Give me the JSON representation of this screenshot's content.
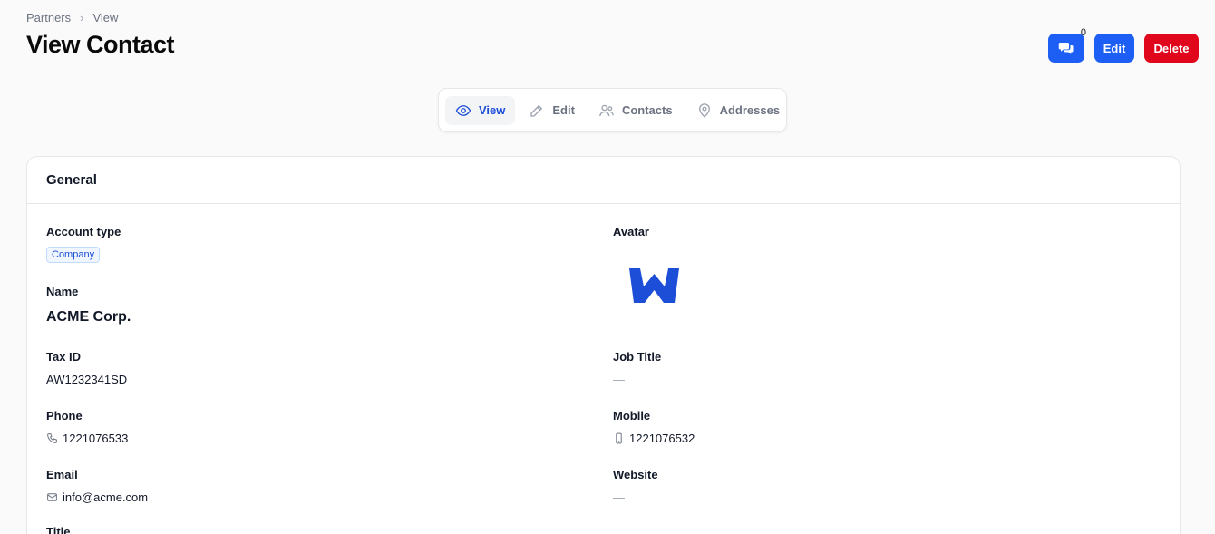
{
  "breadcrumb": {
    "parent": "Partners",
    "separator": "›",
    "current": "View"
  },
  "page": {
    "title": "View Contact"
  },
  "actions": {
    "comments_count": "0",
    "edit_label": "Edit",
    "delete_label": "Delete"
  },
  "tabs": [
    {
      "label": "View",
      "icon": "eye-icon",
      "active": true
    },
    {
      "label": "Edit",
      "icon": "pencil-icon",
      "active": false
    },
    {
      "label": "Contacts",
      "icon": "users-icon",
      "active": false
    },
    {
      "label": "Addresses",
      "icon": "map-pin-icon",
      "active": false
    }
  ],
  "section": {
    "title": "General"
  },
  "fields": {
    "account_type": {
      "label": "Account type",
      "value": "Company"
    },
    "avatar": {
      "label": "Avatar",
      "value": "W"
    },
    "name": {
      "label": "Name",
      "value": "ACME Corp."
    },
    "tax_id": {
      "label": "Tax ID",
      "value": "AW1232341SD"
    },
    "job_title": {
      "label": "Job Title",
      "value": "—"
    },
    "phone": {
      "label": "Phone",
      "value": "1221076533"
    },
    "mobile": {
      "label": "Mobile",
      "value": "1221076532"
    },
    "email": {
      "label": "Email",
      "value": "info@acme.com"
    },
    "website": {
      "label": "Website",
      "value": "—"
    },
    "title": {
      "label": "Title"
    }
  },
  "colors": {
    "primary": "#1d5ff5",
    "danger": "#e0061b",
    "logo": "#1d4ed8"
  }
}
